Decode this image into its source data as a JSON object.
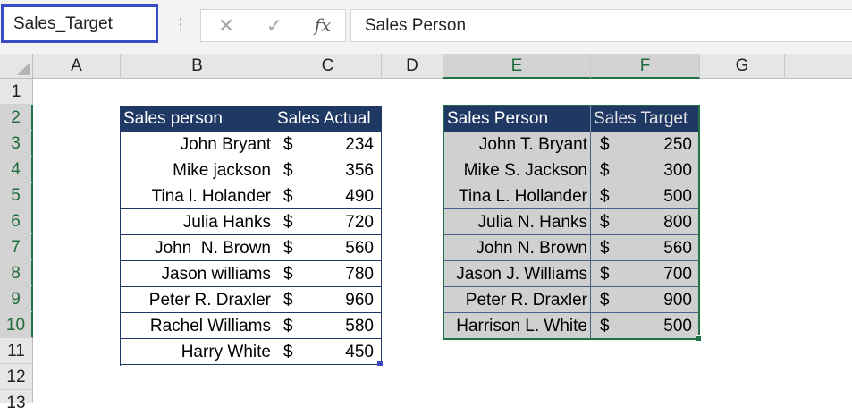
{
  "formula_bar": {
    "name_box": "Sales_Target",
    "dots": "⋮",
    "cancel": "✕",
    "enter": "✓",
    "fx": "fx",
    "formula": "Sales Person"
  },
  "columns": [
    "A",
    "B",
    "C",
    "D",
    "E",
    "F",
    "G"
  ],
  "rows": [
    "1",
    "2",
    "3",
    "4",
    "5",
    "6",
    "7",
    "8",
    "9",
    "10",
    "11",
    "12",
    "13"
  ],
  "table_actual": {
    "headers": [
      "Sales person",
      "Sales Actual"
    ],
    "rows": [
      {
        "name": "John Bryant",
        "cur": "$",
        "amount": "234"
      },
      {
        "name": "Mike jackson",
        "cur": "$",
        "amount": "356"
      },
      {
        "name": "Tina l. Holander",
        "cur": "$",
        "amount": "490"
      },
      {
        "name": "Julia Hanks",
        "cur": "$",
        "amount": "720"
      },
      {
        "name": "John  N. Brown",
        "cur": "$",
        "amount": "560"
      },
      {
        "name": "Jason williams",
        "cur": "$",
        "amount": "780"
      },
      {
        "name": "Peter R. Draxler",
        "cur": "$",
        "amount": "960"
      },
      {
        "name": "Rachel Williams",
        "cur": "$",
        "amount": "580"
      },
      {
        "name": "Harry White",
        "cur": "$",
        "amount": "450"
      }
    ]
  },
  "table_target": {
    "headers": [
      "Sales Person",
      "Sales Target"
    ],
    "rows": [
      {
        "name": "John T. Bryant",
        "cur": "$",
        "amount": "250"
      },
      {
        "name": "Mike S. Jackson",
        "cur": "$",
        "amount": "300"
      },
      {
        "name": "Tina L. Hollander",
        "cur": "$",
        "amount": "500"
      },
      {
        "name": "Julia N. Hanks",
        "cur": "$",
        "amount": "800"
      },
      {
        "name": "John N. Brown",
        "cur": "$",
        "amount": "560"
      },
      {
        "name": "Jason J. Williams",
        "cur": "$",
        "amount": "700"
      },
      {
        "name": "Peter R. Draxler",
        "cur": "$",
        "amount": "900"
      },
      {
        "name": "Harrison L. White",
        "cur": "$",
        "amount": "500"
      }
    ]
  },
  "colors": {
    "header_fill": "#1f3864",
    "selection": "#217346",
    "name_box_border": "#3b4cc0",
    "selected_fill": "#d0d0d0"
  }
}
